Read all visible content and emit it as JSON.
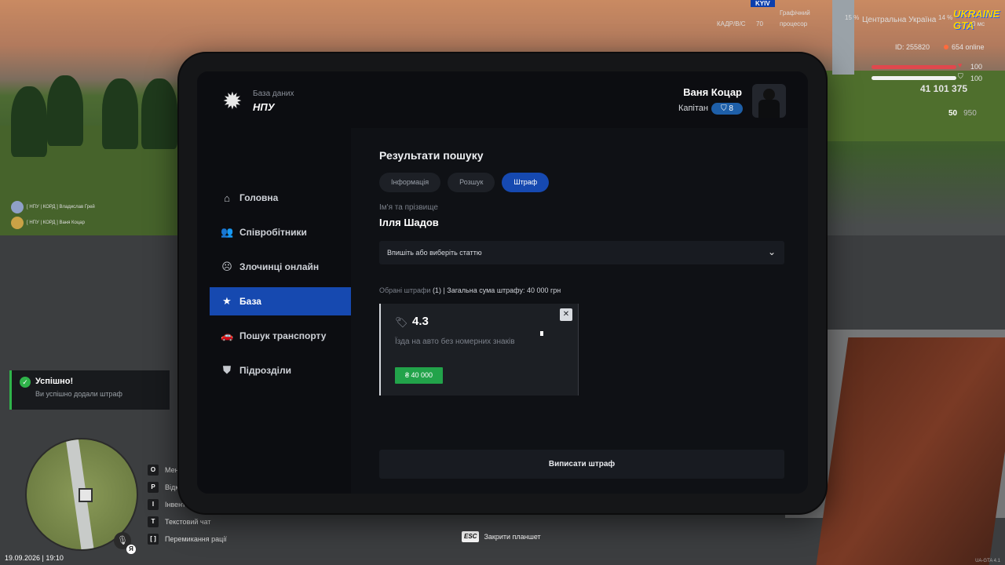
{
  "hud": {
    "id": "ID: 255820",
    "online": "654 online",
    "health": "100",
    "armor": "100",
    "money": "41 101 375",
    "ammo": "50",
    "ammo_reserve": "950",
    "top_kadr": "КАДР/В/С",
    "top_kadr_val": "70",
    "top_cpu": "процесор",
    "top_graphics": "Графічний",
    "top_region": "Центральна Україна",
    "top_region_pct": "14 %",
    "top_pct": "15 %",
    "top_ms": "0 мс",
    "top_sign": "KYIV",
    "logo": "UKRAINE GTA",
    "version": "UA-GTA 4.1"
  },
  "feed": [
    "[ НПУ | КОРД ] Владислав Грей",
    "[ НПУ | КОРД ] Ваня Коцар"
  ],
  "toast": {
    "title": "Успішно!",
    "message": "Ви успішно додали штраф"
  },
  "keys": [
    {
      "key": "O",
      "label": "Мен"
    },
    {
      "key": "P",
      "label": "Відк"
    },
    {
      "key": "I",
      "label": "Інвент"
    },
    {
      "key": "T",
      "label": "Текстовий чат"
    },
    {
      "key": "[   ]",
      "label": "Перемикання рації"
    }
  ],
  "datetime": "19.09.2026 | 19:10",
  "esc": {
    "key": "ESC",
    "label": "Закрити планшет"
  },
  "tablet": {
    "brand_small": "База даних",
    "brand_big": "НПУ",
    "user": {
      "name": "Ваня Коцар",
      "rank": "Капітан",
      "level": "8"
    },
    "nav": [
      {
        "label": "Головна",
        "icon": "home-icon",
        "active": false
      },
      {
        "label": "Співробітники",
        "icon": "users-icon",
        "active": false
      },
      {
        "label": "Злочинці онлайн",
        "icon": "criminal-icon",
        "active": false
      },
      {
        "label": "База",
        "icon": "star-icon",
        "active": true
      },
      {
        "label": "Пошук транспорту",
        "icon": "car-icon",
        "active": false
      },
      {
        "label": "Підрозділи",
        "icon": "shield-icon",
        "active": false
      }
    ],
    "title": "Результати пошуку",
    "tabs": [
      {
        "label": "Інформація",
        "active": false
      },
      {
        "label": "Розшук",
        "active": false
      },
      {
        "label": "Штраф",
        "active": true
      }
    ],
    "field_label": "Ім'я та прізвище",
    "field_value": "Ілля Шадов",
    "select_placeholder": "Впишіть або виберіть статтю",
    "summary_muted": "Обрані штрафи",
    "summary_rest": "(1) | Загальна сума штрафу: 40 000 грн",
    "fine": {
      "code": "4.3",
      "description": "Їзда на авто без номерних знаків",
      "amount": "₴ 40 000"
    },
    "submit": "Виписати штраф"
  },
  "colors": {
    "accent": "#1649b0",
    "success": "#22a34a",
    "panel": "#0f1115"
  }
}
